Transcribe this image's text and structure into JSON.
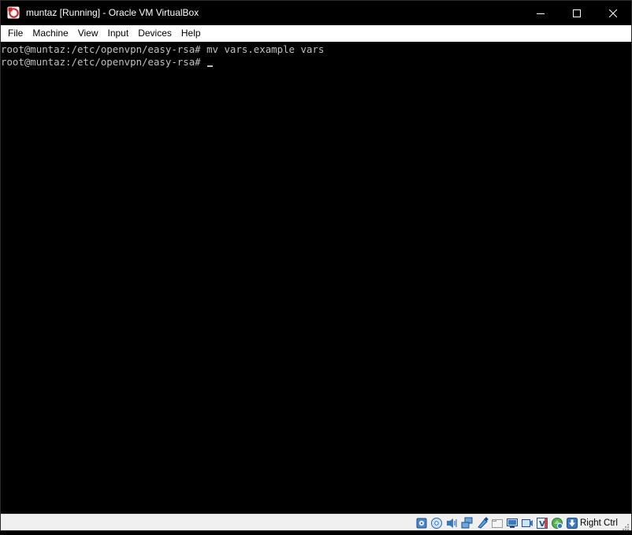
{
  "window": {
    "title": "muntaz [Running] - Oracle VM VirtualBox"
  },
  "menu": {
    "items": [
      "File",
      "Machine",
      "View",
      "Input",
      "Devices",
      "Help"
    ]
  },
  "terminal": {
    "lines": [
      "root@muntaz:/etc/openvpn/easy-rsa# mv vars.example vars",
      "root@muntaz:/etc/openvpn/easy-rsa# "
    ]
  },
  "statusbar": {
    "icons": [
      "hard-disk-icon",
      "optical-drive-icon",
      "audio-icon",
      "network-icon",
      "usb-icon",
      "shared-folders-icon",
      "display-icon",
      "recording-icon",
      "vt-x-icon",
      "guest-additions-icon",
      "mouse-integration-icon"
    ],
    "host_key": "Right Ctrl"
  },
  "colors": {
    "titlebar_bg": "#000000",
    "terminal_bg": "#000000",
    "terminal_fg": "#c0c0c0",
    "app_icon": "#d02a2a"
  }
}
